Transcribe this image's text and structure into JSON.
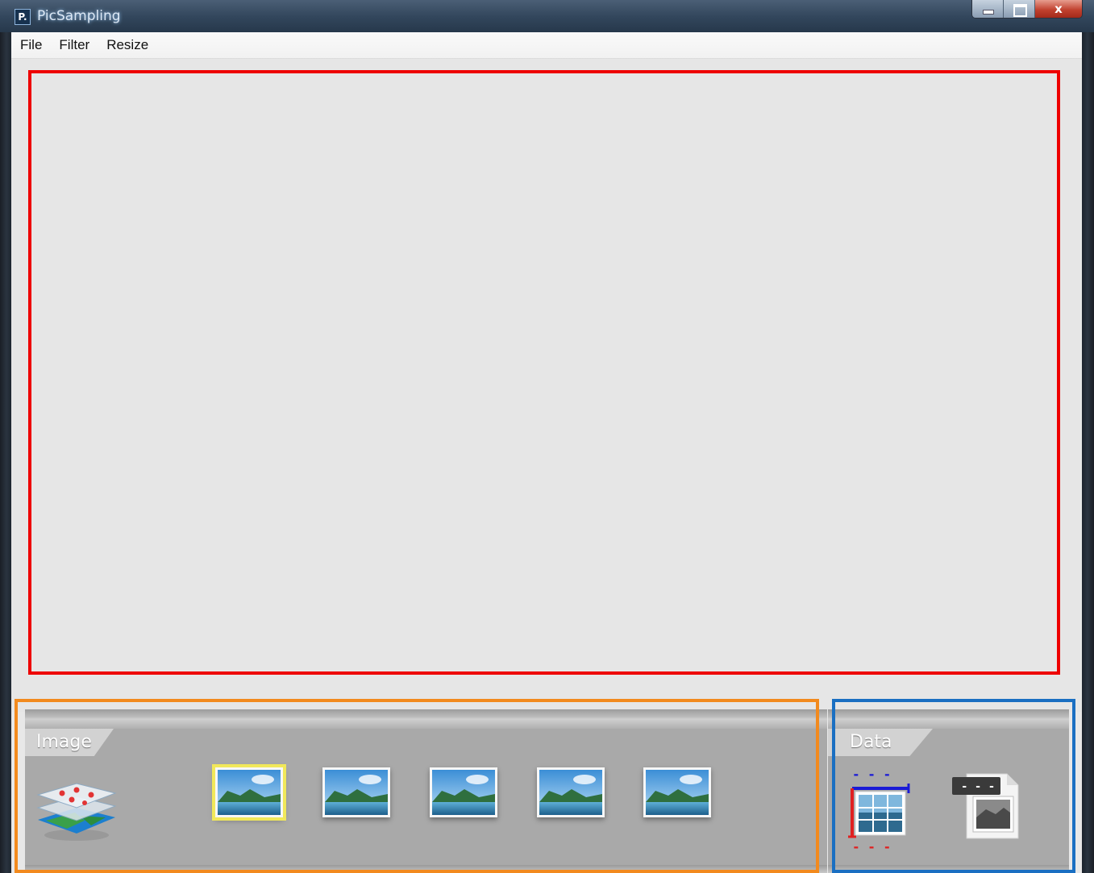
{
  "window": {
    "title": "PicSampling",
    "app_icon_letter": "P.",
    "controls": {
      "minimize": "minimize-icon",
      "maximize": "maximize-icon",
      "close": "close-icon",
      "close_glyph": "x"
    }
  },
  "menu": {
    "items": [
      "File",
      "Filter",
      "Resize"
    ]
  },
  "bottom_panels": {
    "image": {
      "label": "Image",
      "layers_icon": "map-layers-icon",
      "thumbnails": [
        {
          "icon": "landscape-image-icon",
          "selected": true
        },
        {
          "icon": "landscape-image-icon",
          "selected": false
        },
        {
          "icon": "landscape-image-icon",
          "selected": false
        },
        {
          "icon": "landscape-image-icon",
          "selected": false
        },
        {
          "icon": "landscape-image-icon",
          "selected": false
        }
      ]
    },
    "data": {
      "label": "Data",
      "items": [
        {
          "icon": "grid-data-icon",
          "top_dash": "- - -",
          "bottom_dash": "- - -"
        },
        {
          "icon": "export-image-icon",
          "tag_text": "- - -"
        }
      ]
    }
  },
  "colors": {
    "highlight_canvas": "#ee0000",
    "highlight_image_panel": "#f28a1e",
    "highlight_data_panel": "#1a6fc2",
    "panel_bg": "#a9a9a9",
    "canvas_bg": "#e6e6e6",
    "selected_thumb_glow": "#f1e85a"
  }
}
